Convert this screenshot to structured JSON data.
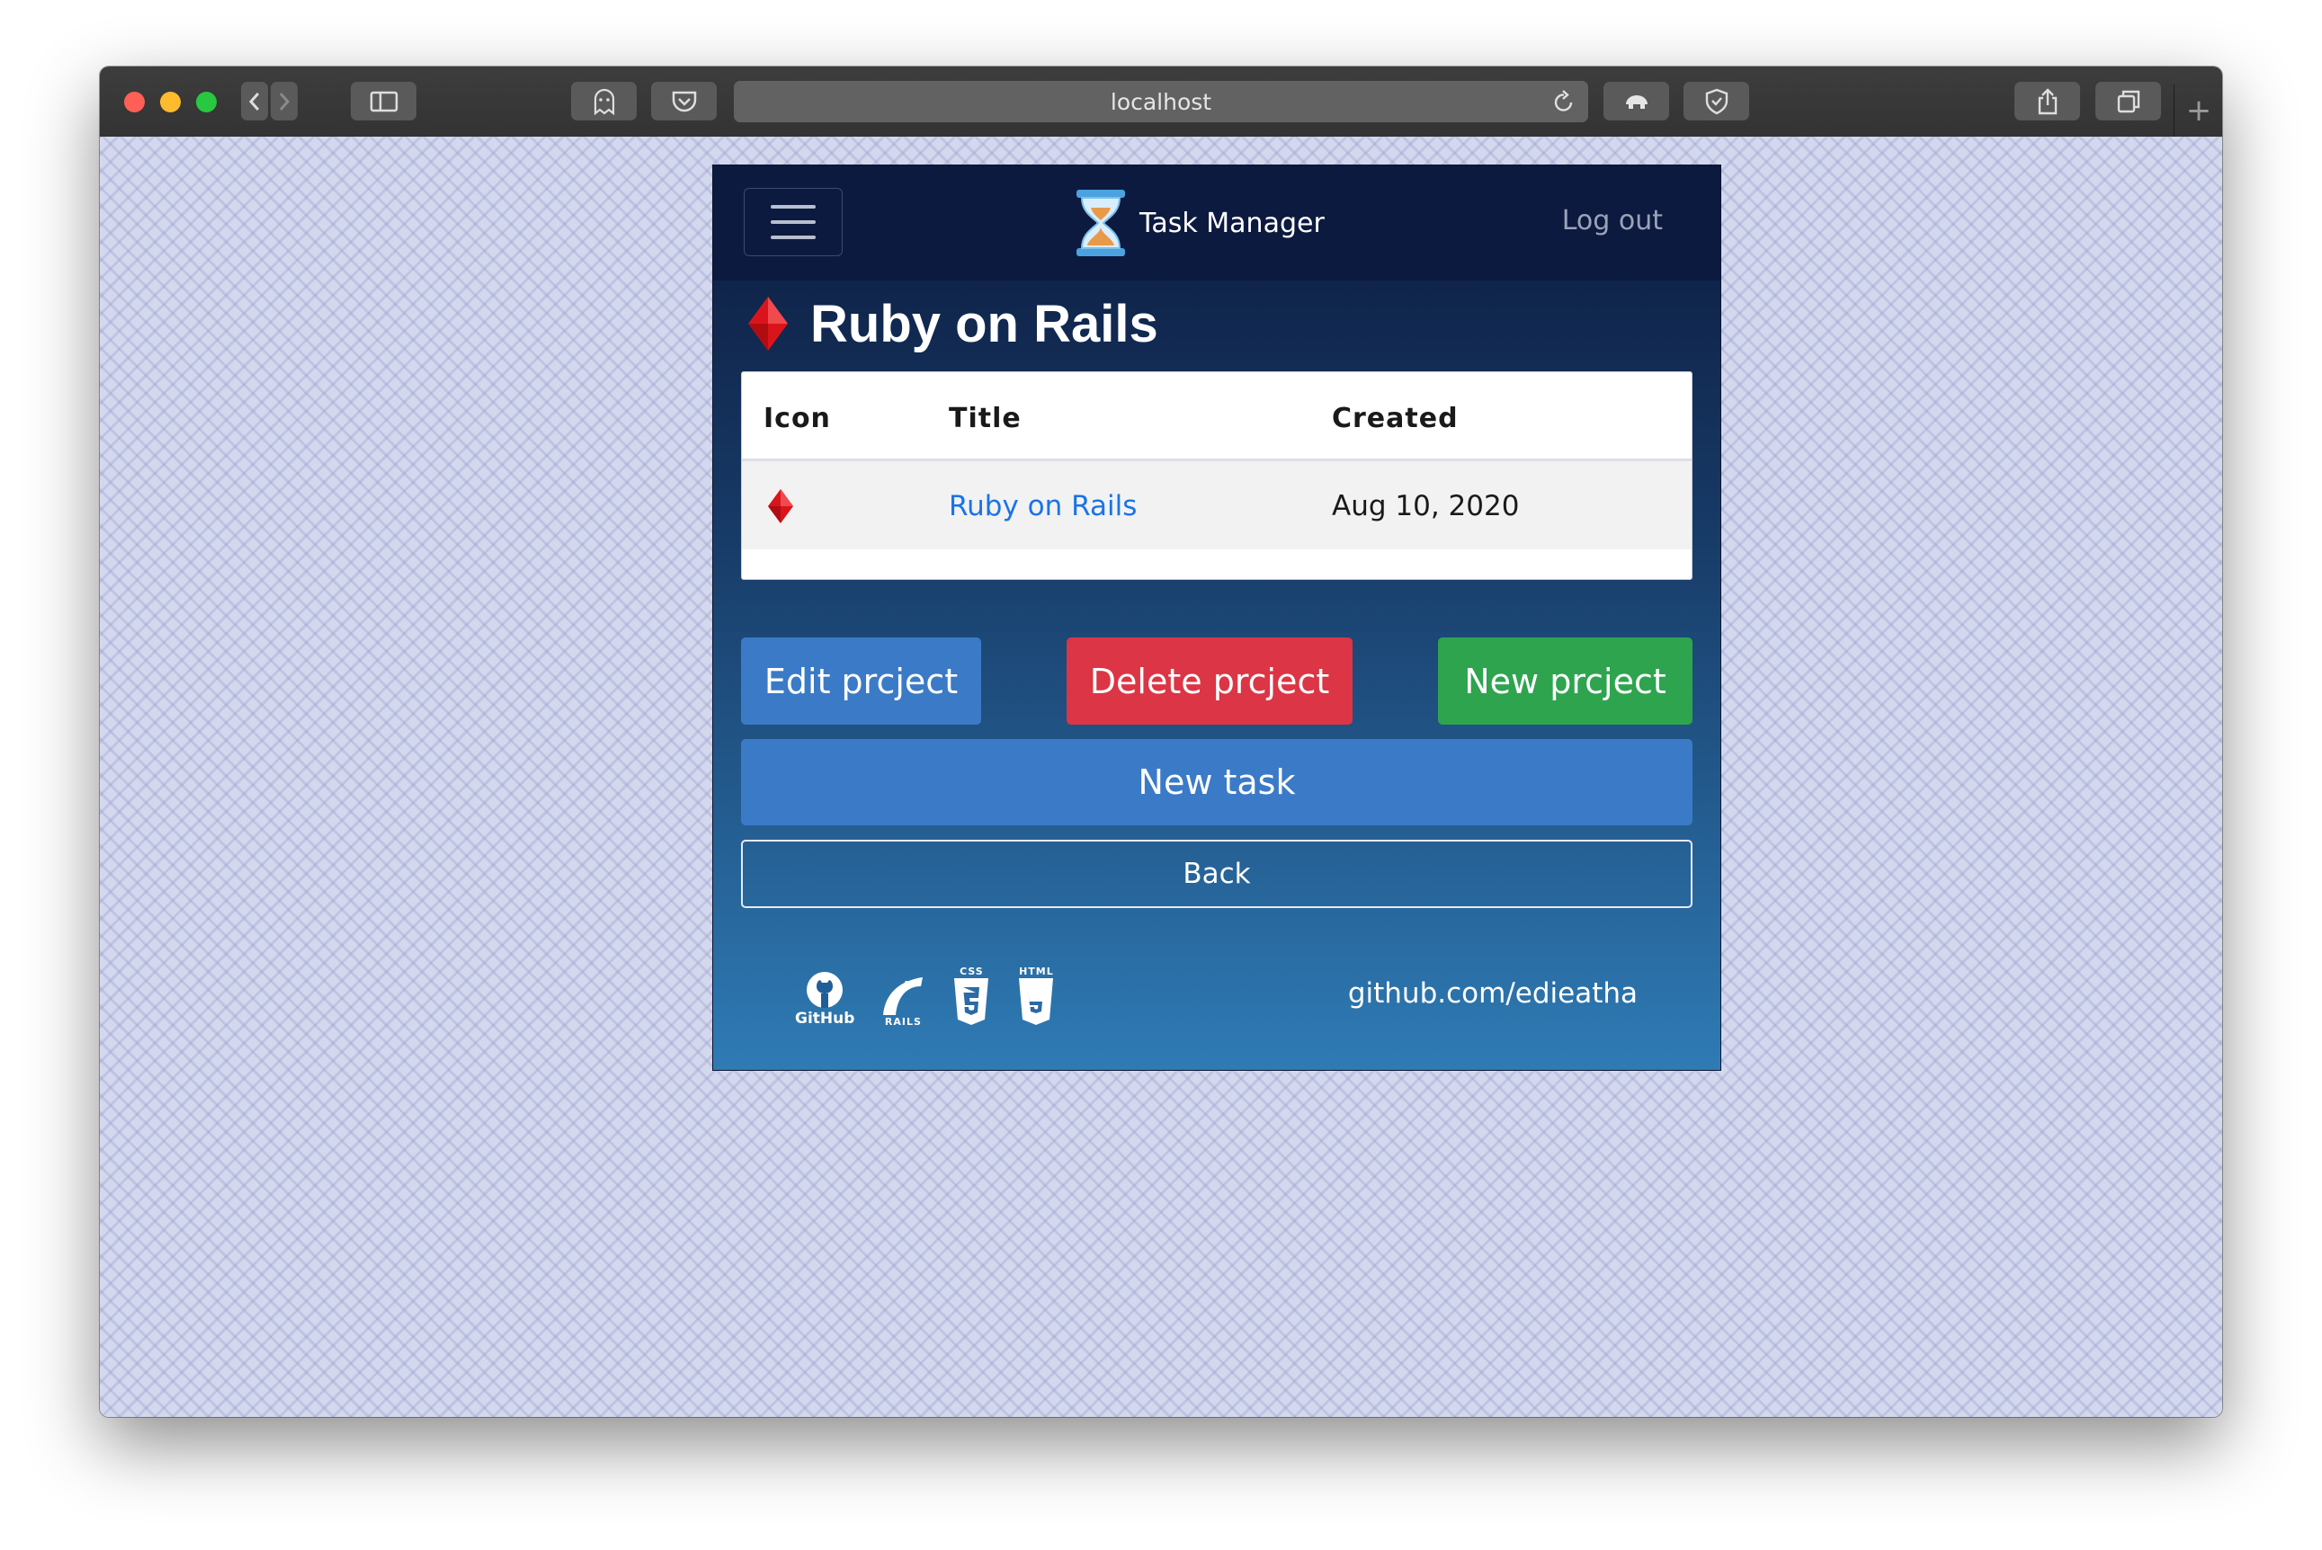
{
  "browser": {
    "address": "localhost",
    "new_tab": "+"
  },
  "navbar": {
    "brand": "Task Manager",
    "logout": "Log out"
  },
  "page": {
    "title": "Ruby on Rails"
  },
  "table": {
    "headers": [
      "Icon",
      "Title",
      "Created"
    ],
    "rows": [
      {
        "icon": "red-diamond-icon",
        "title": "Ruby on Rails",
        "created": "Aug 10, 2020"
      }
    ]
  },
  "actions": {
    "edit": "Edit prcject",
    "delete": "Delete prcject",
    "new_project": "New prcject",
    "new_task": "New task",
    "back": "Back"
  },
  "footer": {
    "icons": [
      {
        "name": "github-icon",
        "caption": "GitHub"
      },
      {
        "name": "rails-icon",
        "caption": "RAILS"
      },
      {
        "name": "css3-icon",
        "caption": "CSS"
      },
      {
        "name": "html5-icon",
        "caption": "HTML"
      }
    ],
    "link": "github.com/edieatha"
  },
  "colors": {
    "primary": "#3b7ac6",
    "danger": "#dc3545",
    "success": "#2ea44f",
    "link": "#1a73e8",
    "navbar": "#0d1a3f"
  }
}
